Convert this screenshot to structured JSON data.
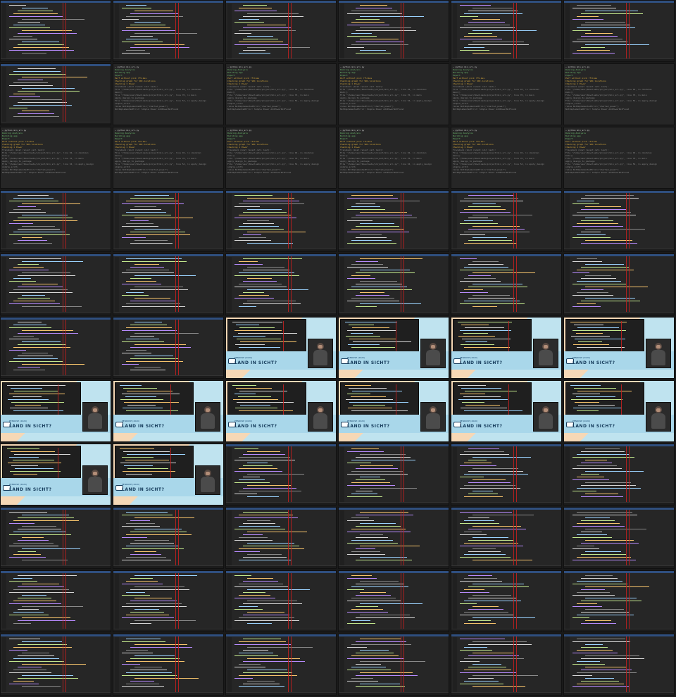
{
  "page": {
    "grid_cols": 6,
    "grid_rows": 11
  },
  "terminal": {
    "prompt": "~ python min_sri.py",
    "lines": [
      "Running Analysis",
      "Building app",
      "Export",
      "Perf without pick rflikes",
      "Checking graph for SRC-locations",
      "Checking 1 Power"
    ],
    "traceback_title": "Traceback (most recent call last):",
    "traceback_lines": [
      "File \"/home/user/Downloads/project/min_sri.py\", line 92, in <module>",
      "main()",
      "File \"/home/user/Downloads/project/min_sri.py\", line 76, in main",
      "apply_design_to_package",
      "File \"/home/user/Downloads/project/min_sri.py\", line 54, in apply_design",
      "simple_arith",
      "raise NotImplementedError(\"charted_power\")",
      "NotImplementedError: Simple Power AddPowerNotFound"
    ]
  },
  "slide": {
    "kicker": "PENROSE (2020)",
    "title": "LAND IN SICHT?"
  }
}
